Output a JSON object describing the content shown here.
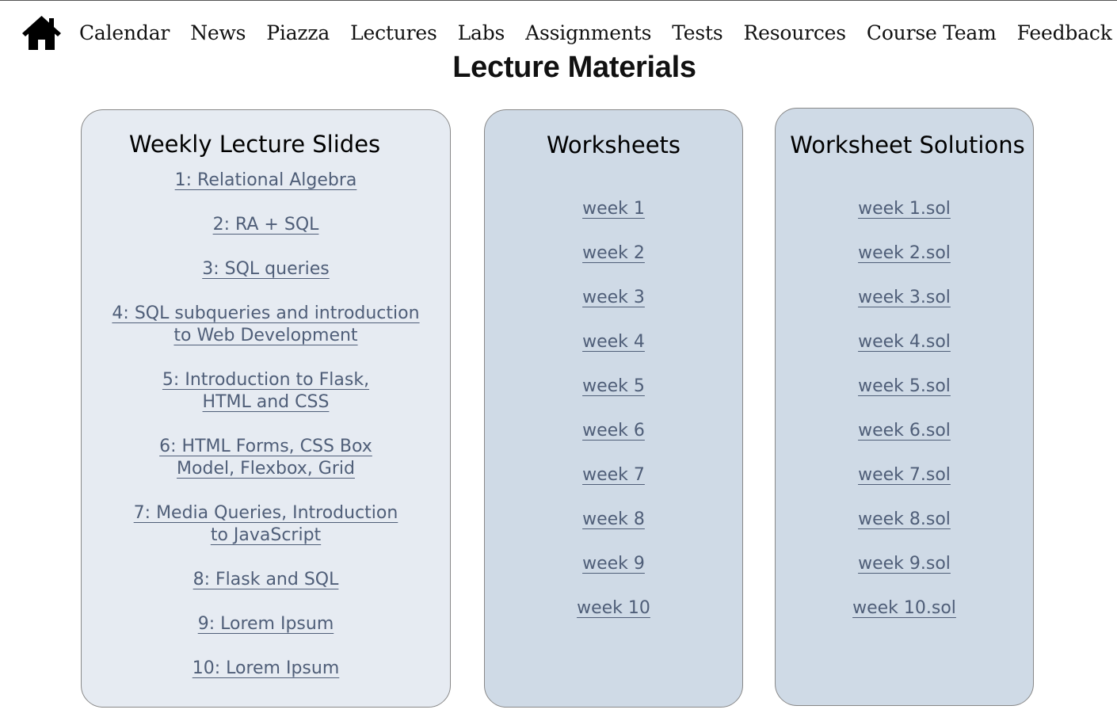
{
  "nav": {
    "home_icon": "home-icon",
    "items": [
      {
        "label": "Calendar"
      },
      {
        "label": "News"
      },
      {
        "label": "Piazza"
      },
      {
        "label": "Lectures"
      },
      {
        "label": "Labs"
      },
      {
        "label": "Assignments"
      },
      {
        "label": "Tests"
      },
      {
        "label": "Resources"
      },
      {
        "label": "Course Team"
      },
      {
        "label": "Feedback"
      }
    ]
  },
  "page": {
    "title": "Lecture Materials"
  },
  "slides": {
    "heading": "Weekly Lecture Slides",
    "items": [
      {
        "label": "1: Relational Algebra"
      },
      {
        "label": "2: RA + SQL"
      },
      {
        "label": "3: SQL queries"
      },
      {
        "label": "4: SQL subqueries and introduction to Web Development"
      },
      {
        "label": "5: Introduction to Flask, HTML and CSS"
      },
      {
        "label": "6: HTML Forms, CSS Box Model, Flexbox, Grid"
      },
      {
        "label": "7: Media Queries, Introduction to JavaScript"
      },
      {
        "label": "8: Flask and SQL"
      },
      {
        "label": "9: Lorem Ipsum"
      },
      {
        "label": "10: Lorem Ipsum"
      }
    ]
  },
  "worksheets": {
    "heading": "Worksheets",
    "items": [
      {
        "label": "week 1"
      },
      {
        "label": "week 2"
      },
      {
        "label": "week 3"
      },
      {
        "label": "week 4"
      },
      {
        "label": "week 5"
      },
      {
        "label": "week 6"
      },
      {
        "label": "week 7"
      },
      {
        "label": "week 8"
      },
      {
        "label": "week 9"
      },
      {
        "label": "week 10"
      }
    ]
  },
  "solutions": {
    "heading": "Worksheet Solutions",
    "items": [
      {
        "label": "week 1.sol"
      },
      {
        "label": "week 2.sol"
      },
      {
        "label": "week 3.sol"
      },
      {
        "label": "week 4.sol"
      },
      {
        "label": "week 5.sol"
      },
      {
        "label": "week 6.sol"
      },
      {
        "label": "week 7.sol"
      },
      {
        "label": "week 8.sol"
      },
      {
        "label": "week 9.sol"
      },
      {
        "label": "week 10.sol"
      }
    ]
  },
  "colors": {
    "link": "#4f5e78",
    "slides_panel_bg": "#e6ebf2",
    "worksheet_panel_bg": "#cfdae6",
    "panel_border": "#888888"
  }
}
